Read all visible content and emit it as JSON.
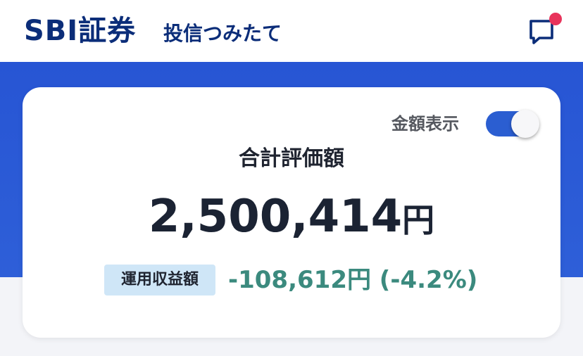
{
  "header": {
    "logo_text": "SBI証券",
    "app_title": "投信つみたて",
    "notification_icon": "chat-bubble-icon",
    "badge_color": "#e8335b"
  },
  "summary": {
    "toggle_label": "金額表示",
    "toggle_on": true,
    "total_label": "合計評価額",
    "total_amount": "2,500,414",
    "currency_unit": "円",
    "profit_label": "運用収益額",
    "profit_value": "-108,612円 (-4.2%)"
  },
  "colors": {
    "brand_navy": "#0b2d79",
    "band_blue": "#2755d4",
    "profit_green": "#3b8a7e",
    "badge_bg": "#cfe6f7"
  }
}
